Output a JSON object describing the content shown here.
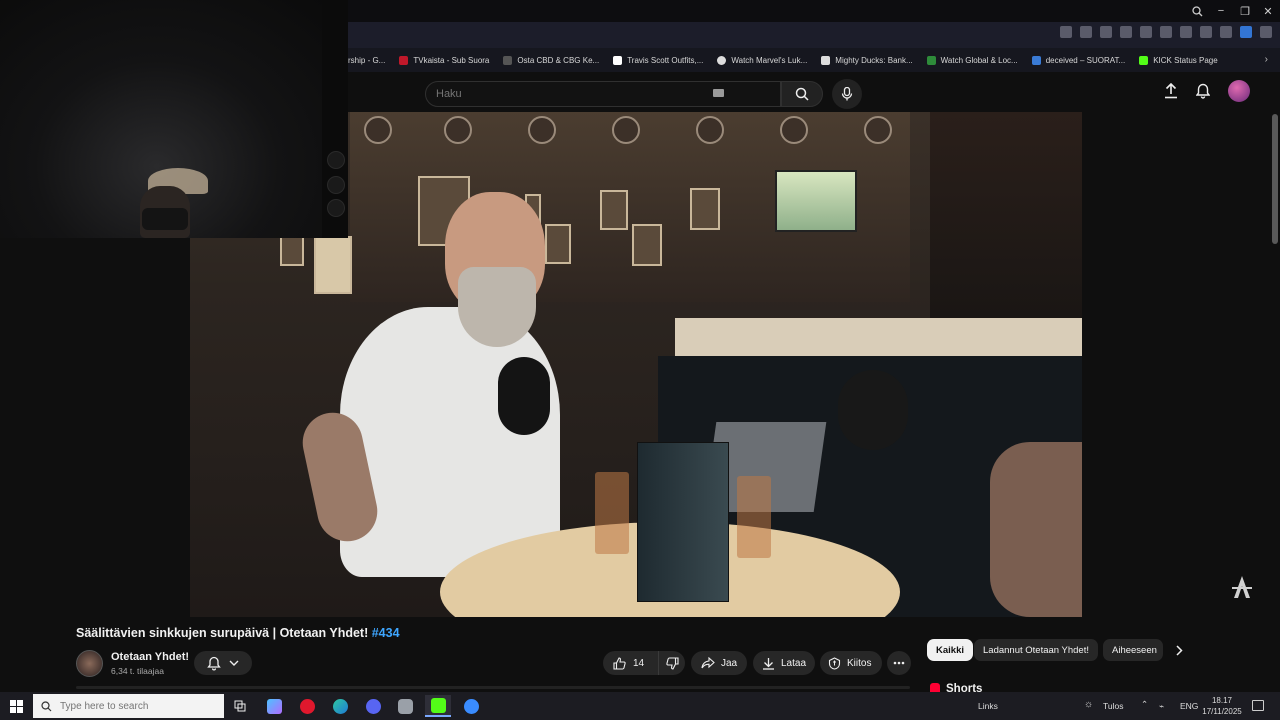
{
  "window": {
    "controls": [
      "−",
      "❐",
      "✕"
    ]
  },
  "bookmarks": [
    {
      "label": "rship - G...",
      "color": "#888888"
    },
    {
      "label": "TVkaista - Sub Suora",
      "color": "#c0182a"
    },
    {
      "label": "Osta CBD & CBG Ke...",
      "color": "#555555"
    },
    {
      "label": "Travis Scott Outfits,...",
      "color": "#ffffff"
    },
    {
      "label": "Watch Marvel's Luk...",
      "color": "#dddddd"
    },
    {
      "label": "Mighty Ducks: Bank...",
      "color": "#dddddd"
    },
    {
      "label": "Watch Global & Loc...",
      "color": "#2e8b3a"
    },
    {
      "label": "deceived – SUORAT...",
      "color": "#3a7bd5"
    },
    {
      "label": "KICK Status Page",
      "color": "#53fc18"
    }
  ],
  "header": {
    "search_placeholder": "Haku"
  },
  "video": {
    "title_main": "Säälittävien sinkkujen surupäivä | Otetaan Yhdet! ",
    "title_tag": "#434"
  },
  "channel": {
    "name": "Otetaan Yhdet!",
    "subscribers": "6,34 t. tilaajaa"
  },
  "actions": {
    "likes": "14",
    "share": "Jaa",
    "download": "Lataa",
    "thanks": "Kiitos"
  },
  "chips": [
    "Kaikki",
    "Ladannut Otetaan Yhdet!",
    "Aiheeseen"
  ],
  "shorts_label": "Shorts",
  "taskbar": {
    "search_placeholder": "Type here to search",
    "links": "Links",
    "weather": "Tulos",
    "language": "ENG",
    "time": "18.17",
    "date": "17/11/2025"
  },
  "colors": {
    "accent_link": "#3ea6ff",
    "shorts_red": "#ff0033"
  }
}
